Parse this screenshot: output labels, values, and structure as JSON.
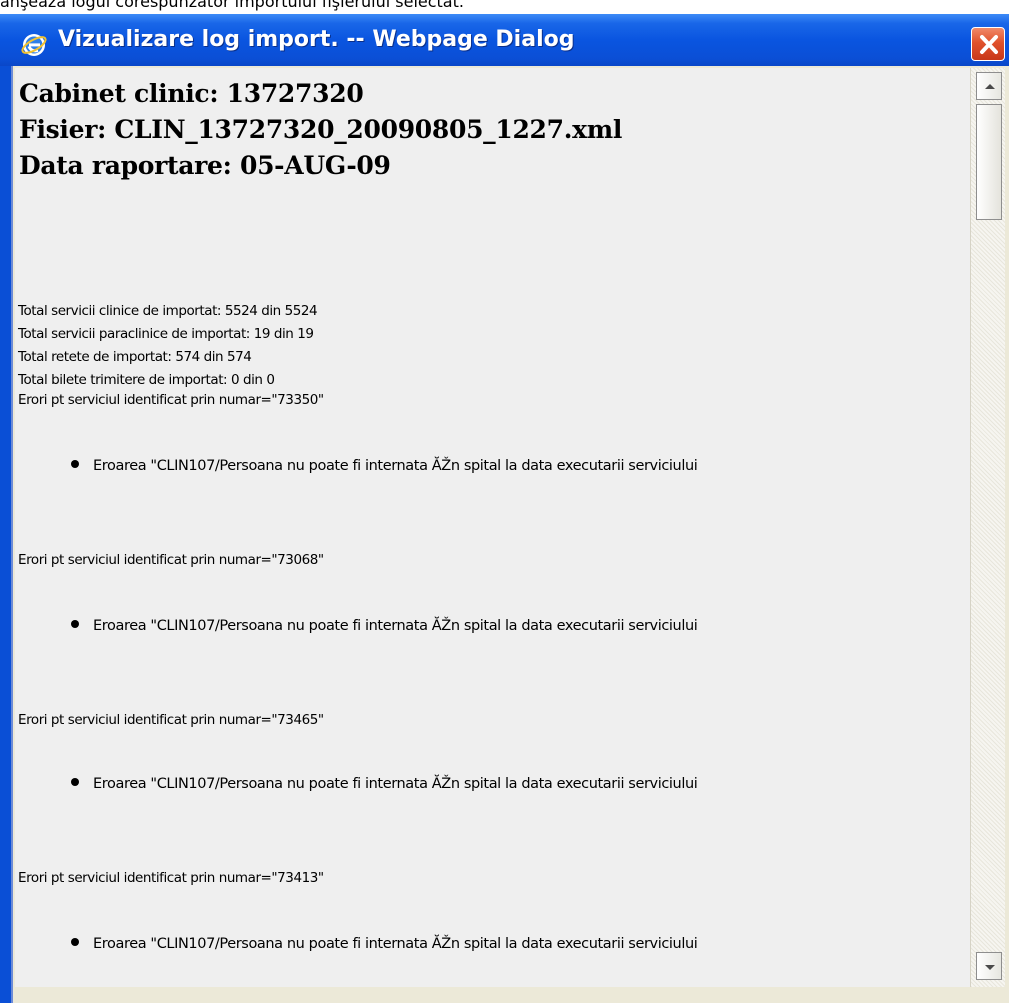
{
  "background_caption": "anşează logul corespunzător importului fişierului selectat.",
  "window": {
    "title": "Vizualizare log import. -- Webpage Dialog",
    "close_symbol": "✕"
  },
  "report": {
    "cabinet": "Cabinet clinic: 13727320",
    "file": "Fisier: CLIN_13727320_20090805_1227.xml",
    "date": "Data raportare: 05-AUG-09",
    "totals": [
      "Total servicii clinice de importat: 5524 din 5524",
      "Total servicii paraclinice de importat: 19 din 19",
      "Total retete de importat: 574 din 574",
      "Total bilete trimitere de importat: 0 din 0"
    ],
    "errors": [
      {
        "header": "Erori pt serviciul identificat prin numar=\"73350\"",
        "message": "Eroarea \"CLIN107/Persoana nu poate fi internata ĂŽn spital la data executarii serviciului"
      },
      {
        "header": "Erori pt serviciul identificat prin numar=\"73068\"",
        "message": "Eroarea \"CLIN107/Persoana nu poate fi internata ĂŽn spital la data executarii serviciului"
      },
      {
        "header": "Erori pt serviciul identificat prin numar=\"73465\"",
        "message": "Eroarea \"CLIN107/Persoana nu poate fi internata ĂŽn spital la data executarii serviciului"
      },
      {
        "header": "Erori pt serviciul identificat prin numar=\"73413\"",
        "message": "Eroarea \"CLIN107/Persoana nu poate fi internata ĂŽn spital la data executarii serviciului"
      }
    ]
  },
  "icons": {
    "window_icon": "internet-explorer-icon",
    "scroll_up": "arrow-up-icon",
    "scroll_down": "arrow-down-icon"
  },
  "colors": {
    "titlebar": "#0a55e0",
    "content_bg": "#efefef",
    "close_button": "#e0522c"
  }
}
